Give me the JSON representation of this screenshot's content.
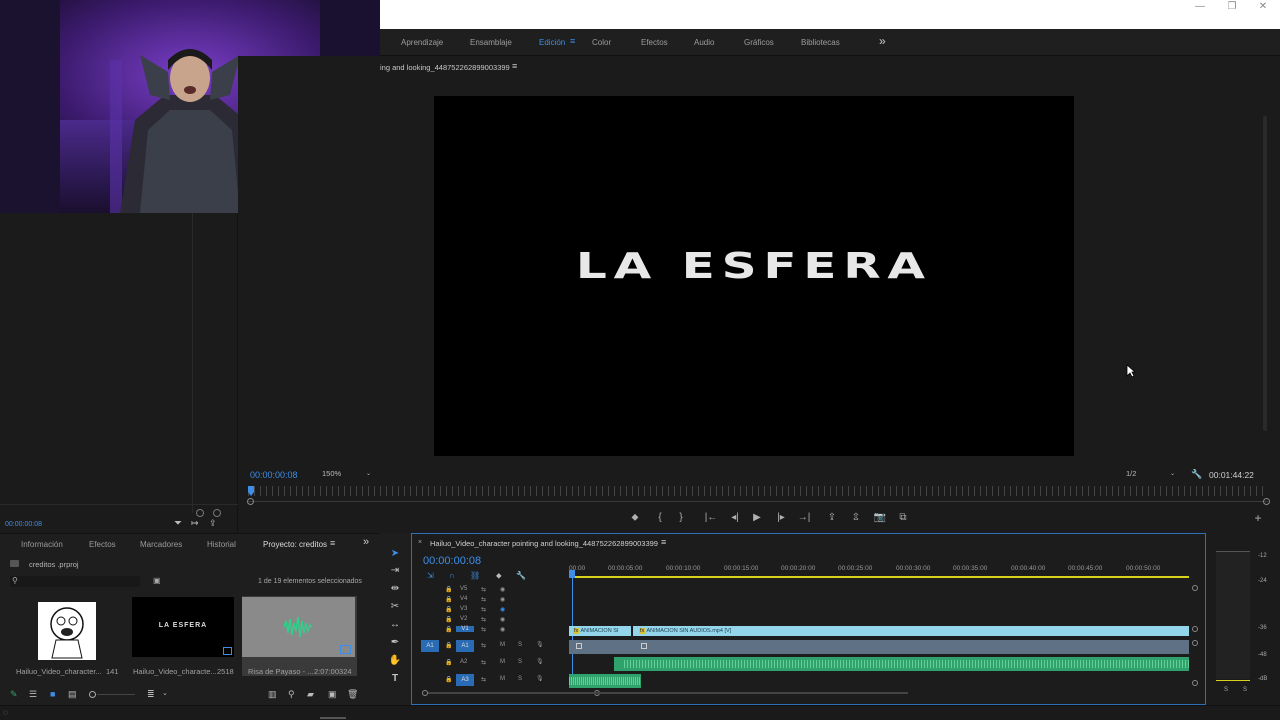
{
  "window": {
    "minimize_glyph": "—",
    "restore_glyph": "❐",
    "close_glyph": "✕"
  },
  "workspaces": {
    "items": [
      "Aprendizaje",
      "Ensamblaje",
      "Edición",
      "Color",
      "Efectos",
      "Audio",
      "Gráficos",
      "Bibliotecas"
    ],
    "active": "Edición",
    "overflow": "»"
  },
  "program_monitor": {
    "sequence_name": "ing and looking_448752262899003399",
    "menu_glyph": "≡",
    "video_title": "LA ESFERA",
    "timecode": "00:00:00:08",
    "zoom": "150%",
    "resolution": "1/2",
    "duration": "00:01:44:22"
  },
  "source_panel": {
    "timecode": "00:00:00:08"
  },
  "transport": {
    "marker": "⬥",
    "mark_in": "{",
    "mark_out": "}",
    "go_in": "|←",
    "step_back": "◂|",
    "play": "▶",
    "step_fwd": "|▸",
    "go_out": "→|",
    "lift": "⇪",
    "extract": "⇫",
    "export_frame": "📷",
    "compare": "⧉",
    "add": "+"
  },
  "project_panel": {
    "tabs": [
      "Información",
      "Efectos",
      "Marcadores",
      "Historial",
      "Proyecto: creditos"
    ],
    "active_tab": "Proyecto: creditos",
    "project_file": "creditos .prproj",
    "selection_status": "1 de 19 elementos seleccionados",
    "items": [
      {
        "name": "Hailuo_Video_character...",
        "duration": "141"
      },
      {
        "name": "Hailuo_Video_characte...",
        "duration": "2518",
        "thumb_text": "LA ESFERA"
      },
      {
        "name": "Risa de Payaso - ...",
        "duration": "2:07:00324"
      }
    ]
  },
  "timeline": {
    "sequence_tab": "Hailuo_Video_character pointing and looking_448752262899003399",
    "timecode": "00:00:00:08",
    "ruler": [
      "00:00",
      "00:00:05:00",
      "00:00:10:00",
      "00:00:15:00",
      "00:00:20:00",
      "00:00:25:00",
      "00:00:30:00",
      "00:00:35:00",
      "00:00:40:00",
      "00:00:45:00",
      "00:00:50:00"
    ],
    "video_tracks": [
      "V5",
      "V4",
      "V3",
      "V2",
      "V1"
    ],
    "audio_tracks": [
      "A1",
      "A2",
      "A3"
    ],
    "source_patch": "A1",
    "clips": {
      "v1_clip1": "ANIMACION SI",
      "v1_clip2": "ANIMACION SIN AUDIOS.mp4 [V]",
      "fx_badge": "fx"
    },
    "mute_label": "M",
    "solo_label": "S"
  },
  "meters": {
    "labels": [
      "-12",
      "-24",
      "-36",
      "-48",
      "-dB"
    ],
    "solo": [
      "S",
      "S"
    ]
  },
  "colors": {
    "accent": "#3d8ee8",
    "video_clip": "#93d6ec",
    "audio_clip": "#2fa36b",
    "playhead": "#3d8ee8"
  }
}
